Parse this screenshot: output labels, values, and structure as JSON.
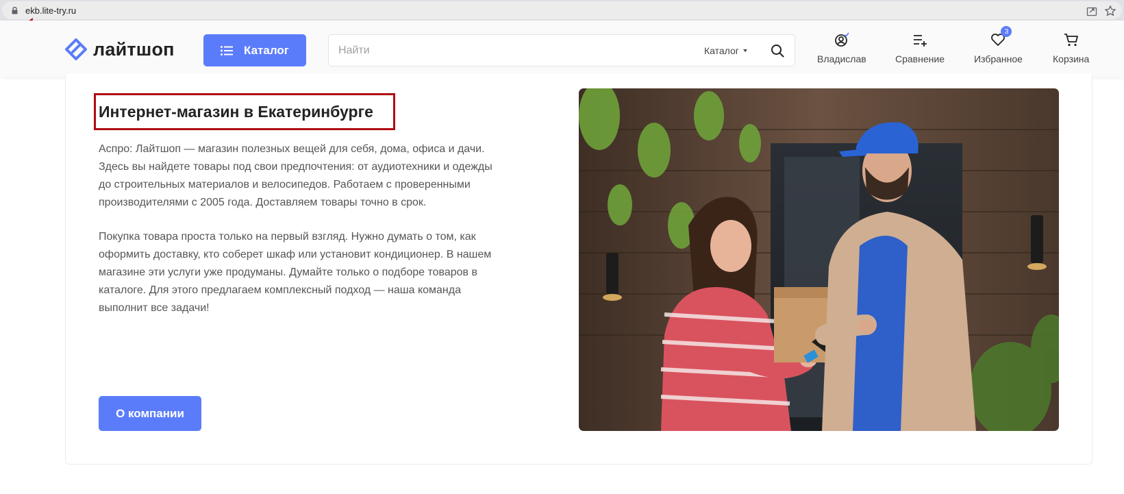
{
  "browser": {
    "url": "ekb.lite-try.ru"
  },
  "header": {
    "logo_text": "лайтшоп",
    "catalog_label": "Каталог",
    "search_placeholder": "Найти",
    "search_scope": "Каталог",
    "user_label": "Владислав",
    "compare_label": "Сравнение",
    "favorites_label": "Избранное",
    "favorites_count": "3",
    "cart_label": "Корзина"
  },
  "main": {
    "title": "Интернет-магазин в Екатеринбурге",
    "paragraph1_line1": "Аспро: Лайтшоп — магазин полезных вещей для себя, дома, офиса и дачи.",
    "paragraph1_line2": "Здесь вы найдете товары под свои предпочтения: от аудиотехники и одежды",
    "paragraph1_line3": "до строительных материалов и велосипедов. Работаем с проверенными",
    "paragraph1_line4": "производителями с 2005 года. Доставляем товары точно в срок.",
    "paragraph2_line1": "Покупка товара проста только на первый взгляд. Нужно думать о том, как",
    "paragraph2_line2": "оформить доставку, кто соберет шкаф или установит кондиционер. В нашем",
    "paragraph2_line3": "магазине эти услуги уже продуманы. Думайте только о подборе товаров в",
    "paragraph2_line4": "каталоге. Для этого предлагаем комплексный подход — наша команда",
    "paragraph2_line5": "выполнит все задачи!",
    "about_button": "О компании"
  },
  "colors": {
    "accent": "#5b7cfa",
    "highlight_box": "#b00a12",
    "arrow": "#b00a12"
  }
}
